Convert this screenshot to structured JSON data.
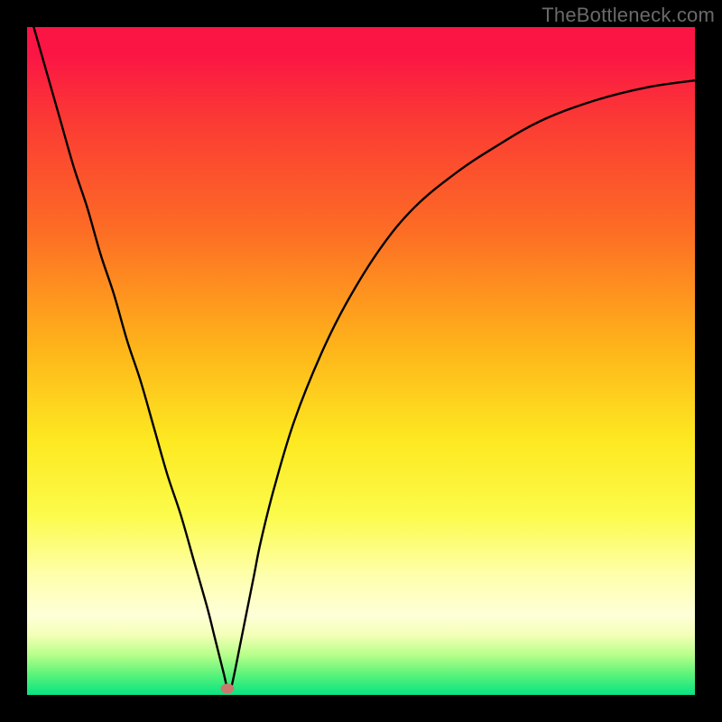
{
  "watermark": "TheBottleneck.com",
  "colors": {
    "frame": "#000000",
    "curve": "#000000",
    "marker": "#c97a6f",
    "gradient_top": "#fb1545",
    "gradient_bottom": "#08e382"
  },
  "chart_data": {
    "type": "line",
    "title": "",
    "xlabel": "",
    "ylabel": "",
    "xlim": [
      0,
      100
    ],
    "ylim": [
      0,
      100
    ],
    "grid": false,
    "x": [
      1,
      3,
      5,
      7,
      9,
      11,
      13,
      15,
      17,
      19,
      21,
      23,
      25,
      27,
      28,
      29,
      29.5,
      30,
      30.5,
      31,
      32,
      33,
      34,
      35,
      37,
      40,
      44,
      48,
      53,
      58,
      64,
      70,
      77,
      85,
      93,
      100
    ],
    "y": [
      100,
      93,
      86,
      79,
      73,
      66,
      60,
      53,
      47,
      40,
      33,
      27,
      20,
      13,
      9,
      5,
      3,
      1,
      1,
      3,
      8,
      13,
      18,
      23,
      31,
      41,
      51,
      59,
      67,
      73,
      78,
      82,
      86,
      89,
      91,
      92
    ],
    "marker_point": {
      "x": 30,
      "y": 1
    },
    "annotations": []
  }
}
